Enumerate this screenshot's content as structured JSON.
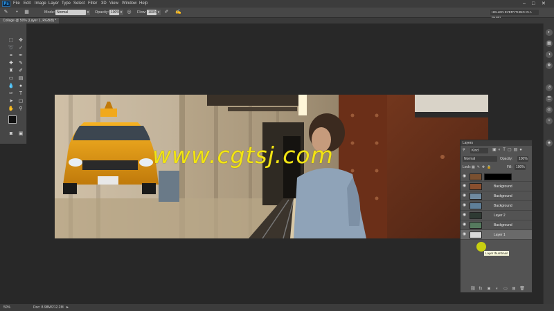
{
  "menubar": {
    "logo": "Ps",
    "items": [
      "File",
      "Edit",
      "Image",
      "Layer",
      "Type",
      "Select",
      "Filter",
      "3D",
      "View",
      "Window",
      "Help"
    ],
    "window_controls": [
      "–",
      "□",
      "✕"
    ]
  },
  "options": {
    "mode_label": "Mode:",
    "mode_value": "Normal",
    "opacity_label": "Opacity:",
    "opacity_value": "100%",
    "flow_label": "Flow:",
    "flow_value": "100%",
    "workspace": "HELLEN EVERYTHING IN A PANEL"
  },
  "document": {
    "tab_title": "Collage @ 50% (Layer 1, RGB/8) *"
  },
  "watermark": "www.cgtsj.com",
  "layers_panel": {
    "title": "Layers",
    "kind_label": "Kind",
    "blend_mode": "Normal",
    "opacity_label": "Opacity:",
    "opacity_value": "100%",
    "lock_label": "Lock:",
    "fill_label": "Fill:",
    "fill_value": "100%",
    "layers": [
      {
        "name": "",
        "thumb": "#7a5030",
        "mask": true
      },
      {
        "name": "Background",
        "thumb": "#8a4f2e",
        "mask": false
      },
      {
        "name": "Background",
        "thumb": "#6f8aa0",
        "mask": false
      },
      {
        "name": "Background",
        "thumb": "#5f7f98",
        "mask": false
      },
      {
        "name": "Layer 2",
        "thumb": "#2e3a33",
        "mask": false
      },
      {
        "name": "Background",
        "thumb": "#557a5e",
        "mask": false
      },
      {
        "name": "Layer 1",
        "thumb": "#d8d8d8",
        "mask": false
      }
    ],
    "tooltip": "Layer thumbnail"
  },
  "status": {
    "zoom": "50%",
    "doc": "Doc: 8.98M/212.2M"
  },
  "colors": {
    "accent": "#31a8ff",
    "watermark": "#f2e414"
  }
}
